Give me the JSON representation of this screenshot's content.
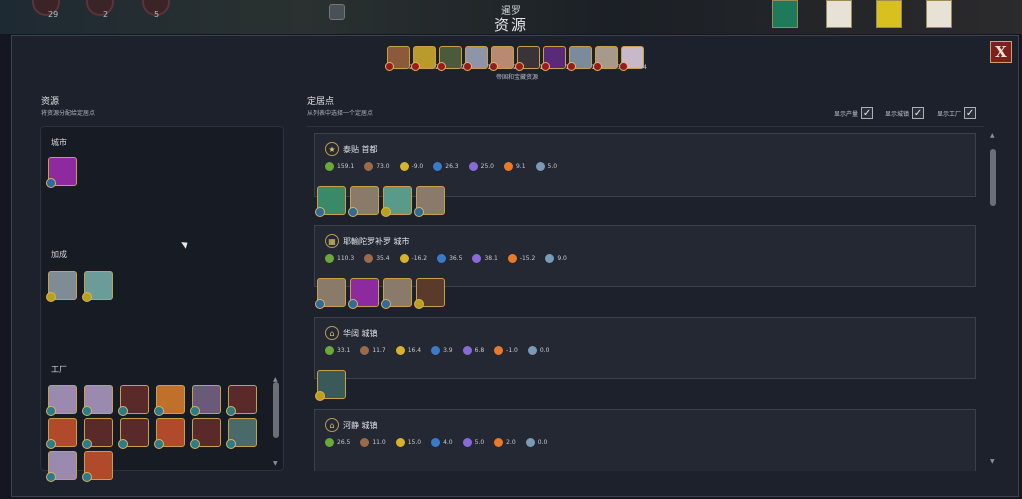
{
  "header": {
    "civ_name": "暹罗",
    "screen_title": "资源",
    "top_counts": [
      "29",
      "2",
      "5"
    ]
  },
  "close_label": "X",
  "empire_resources": {
    "caption": "帝国和宝藏资源",
    "icons": [
      {
        "name": "copper",
        "count": "2",
        "color": "#8b5a3a"
      },
      {
        "name": "gold",
        "count": "2",
        "color": "#b89b2a"
      },
      {
        "name": "iron",
        "count": "2",
        "color": "#4b5a3a"
      },
      {
        "name": "silver",
        "count": "1",
        "color": "#8c96a8"
      },
      {
        "name": "ivory",
        "count": "2",
        "color": "#b88a72"
      },
      {
        "name": "coal",
        "count": "1",
        "color": "#3a3438"
      },
      {
        "name": "dyes",
        "count": "1",
        "color": "#5a2a7a"
      },
      {
        "name": "pearls",
        "count": "1",
        "color": "#7a8c9c"
      },
      {
        "name": "cotton",
        "count": "3",
        "color": "#a89a8a"
      },
      {
        "name": "silk",
        "count": "4",
        "color": "#c8b8c8"
      }
    ]
  },
  "left": {
    "title": "资源",
    "subtitle": "将资源分配给定居点",
    "sections": [
      {
        "label": "城市",
        "items": [
          {
            "name": "silk-resource",
            "color": "#8e2aa0",
            "pip": "blue"
          }
        ]
      },
      {
        "label": "加成",
        "items": [
          {
            "name": "salt-resource",
            "color": "#7f8c96",
            "pip": "gold"
          },
          {
            "name": "salt-resource",
            "color": "#6c9c9a",
            "pip": "gold"
          }
        ]
      },
      {
        "label": "工厂",
        "items": [
          {
            "name": "cotton-resource",
            "color": "#9a8ab0",
            "pip": "teal"
          },
          {
            "name": "cotton-resource",
            "color": "#9a8ab0",
            "pip": "teal"
          },
          {
            "name": "wine-resource",
            "color": "#5a2a2a",
            "pip": "teal"
          },
          {
            "name": "citrus-resource",
            "color": "#c0702a",
            "pip": "teal"
          },
          {
            "name": "spices-resource",
            "color": "#6a5a7a",
            "pip": "teal"
          },
          {
            "name": "wine-resource",
            "color": "#5a2a2a",
            "pip": "teal"
          },
          {
            "name": "sugar-resource",
            "color": "#b04a2a",
            "pip": "teal"
          },
          {
            "name": "wine-resource",
            "color": "#5a2a2a",
            "pip": "teal"
          },
          {
            "name": "wine-resource",
            "color": "#5a2a2a",
            "pip": "teal"
          },
          {
            "name": "sugar-resource",
            "color": "#b04a2a",
            "pip": "teal"
          },
          {
            "name": "wine-resource",
            "color": "#5a2a2a",
            "pip": "teal"
          },
          {
            "name": "tea-resource",
            "color": "#4a6a6a",
            "pip": "teal"
          },
          {
            "name": "cotton-resource",
            "color": "#9a8ab0",
            "pip": "teal"
          },
          {
            "name": "sugar-resource",
            "color": "#b04a2a",
            "pip": "teal"
          }
        ]
      }
    ]
  },
  "right": {
    "title": "定居点",
    "subtitle": "从列表中选择一个定居点",
    "toggles": [
      {
        "label": "显示产量",
        "checked": true
      },
      {
        "label": "显示城镇",
        "checked": true
      },
      {
        "label": "显示工厂",
        "checked": true
      }
    ],
    "settlements": [
      {
        "name": "泰贴 首都",
        "icon": "capital-star-icon",
        "yields": {
          "food": "159.1",
          "production": "73.0",
          "gold": "-9.0",
          "science": "26.3",
          "culture": "25.0",
          "happiness": "9.1",
          "influence": "5.0"
        },
        "resources": [
          {
            "name": "fish-resource",
            "color": "#3a8a6a",
            "pip": "blue"
          },
          {
            "name": "pearls-resource",
            "color": "#8a7a6a",
            "pip": "blue"
          },
          {
            "name": "salt-resource",
            "color": "#5a9a8a",
            "pip": "gold"
          },
          {
            "name": "pearls-resource",
            "color": "#8a7a6a",
            "pip": "blue"
          }
        ]
      },
      {
        "name": "耶輸陀罗补罗 城市",
        "icon": "city-icon",
        "yields": {
          "food": "110.3",
          "production": "35.4",
          "gold": "-16.2",
          "science": "36.5",
          "culture": "38.1",
          "happiness": "-15.2",
          "influence": "9.0"
        },
        "resources": [
          {
            "name": "pearls-resource",
            "color": "#8a7a6a",
            "pip": "blue"
          },
          {
            "name": "silk-resource",
            "color": "#8e2aa0",
            "pip": "blue"
          },
          {
            "name": "pearls-resource",
            "color": "#8a7a6a",
            "pip": "blue"
          },
          {
            "name": "wine-resource",
            "color": "#5a3a2a",
            "pip": "gold"
          }
        ]
      },
      {
        "name": "华阔 城镇",
        "icon": "town-icon",
        "yields": {
          "food": "33.1",
          "production": "11.7",
          "gold": "16.4",
          "science": "3.9",
          "culture": "6.8",
          "happiness": "-1.0",
          "influence": "0.0"
        },
        "resources": [
          {
            "name": "fish-resource",
            "color": "#3a5a5a",
            "pip": "gold"
          }
        ]
      },
      {
        "name": "河静 城镇",
        "icon": "town-icon",
        "yields": {
          "food": "26.5",
          "production": "11.0",
          "gold": "15.0",
          "science": "4.0",
          "culture": "5.0",
          "happiness": "2.0",
          "influence": "0.0"
        },
        "resources": []
      }
    ]
  },
  "colors": {
    "accent_gold": "#c8a04a",
    "close_red": "#7d1f1f",
    "panel_bg": "#1d212b"
  }
}
